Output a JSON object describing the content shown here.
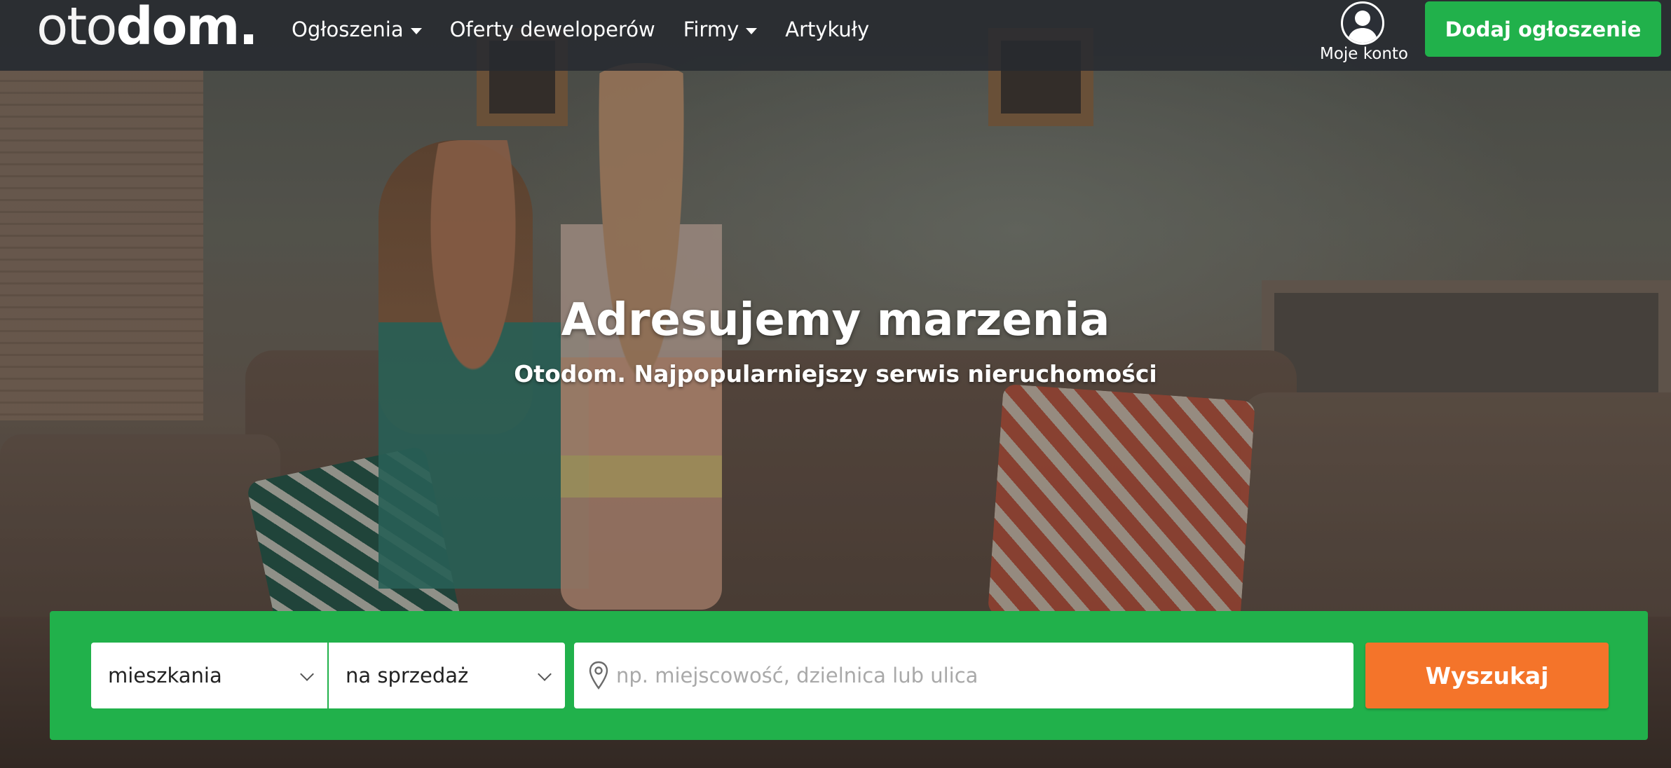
{
  "brand": {
    "logo_thin": "oto",
    "logo_bold": "dom",
    "logo_dot": "."
  },
  "nav": {
    "items": [
      {
        "label": "Ogłoszenia",
        "dropdown": true
      },
      {
        "label": "Oferty deweloperów",
        "dropdown": false
      },
      {
        "label": "Firmy",
        "dropdown": true
      },
      {
        "label": "Artykuły",
        "dropdown": false
      }
    ]
  },
  "account": {
    "label": "Moje konto",
    "icon": "user-avatar-icon"
  },
  "add_listing": {
    "label": "Dodaj ogłoszenie"
  },
  "hero": {
    "title": "Adresujemy marzenia",
    "subtitle": "Otodom. Najpopularniejszy serwis nieruchomości"
  },
  "search": {
    "property_type": "mieszkania",
    "transaction_type": "na sprzedaż",
    "location_placeholder": "np. miejscowość, dzielnica lub ulica",
    "location_value": "",
    "submit_label": "Wyszukaj"
  },
  "colors": {
    "brand_green": "#21b14b",
    "search_orange": "#f4742a",
    "topbar": "#262a30"
  }
}
